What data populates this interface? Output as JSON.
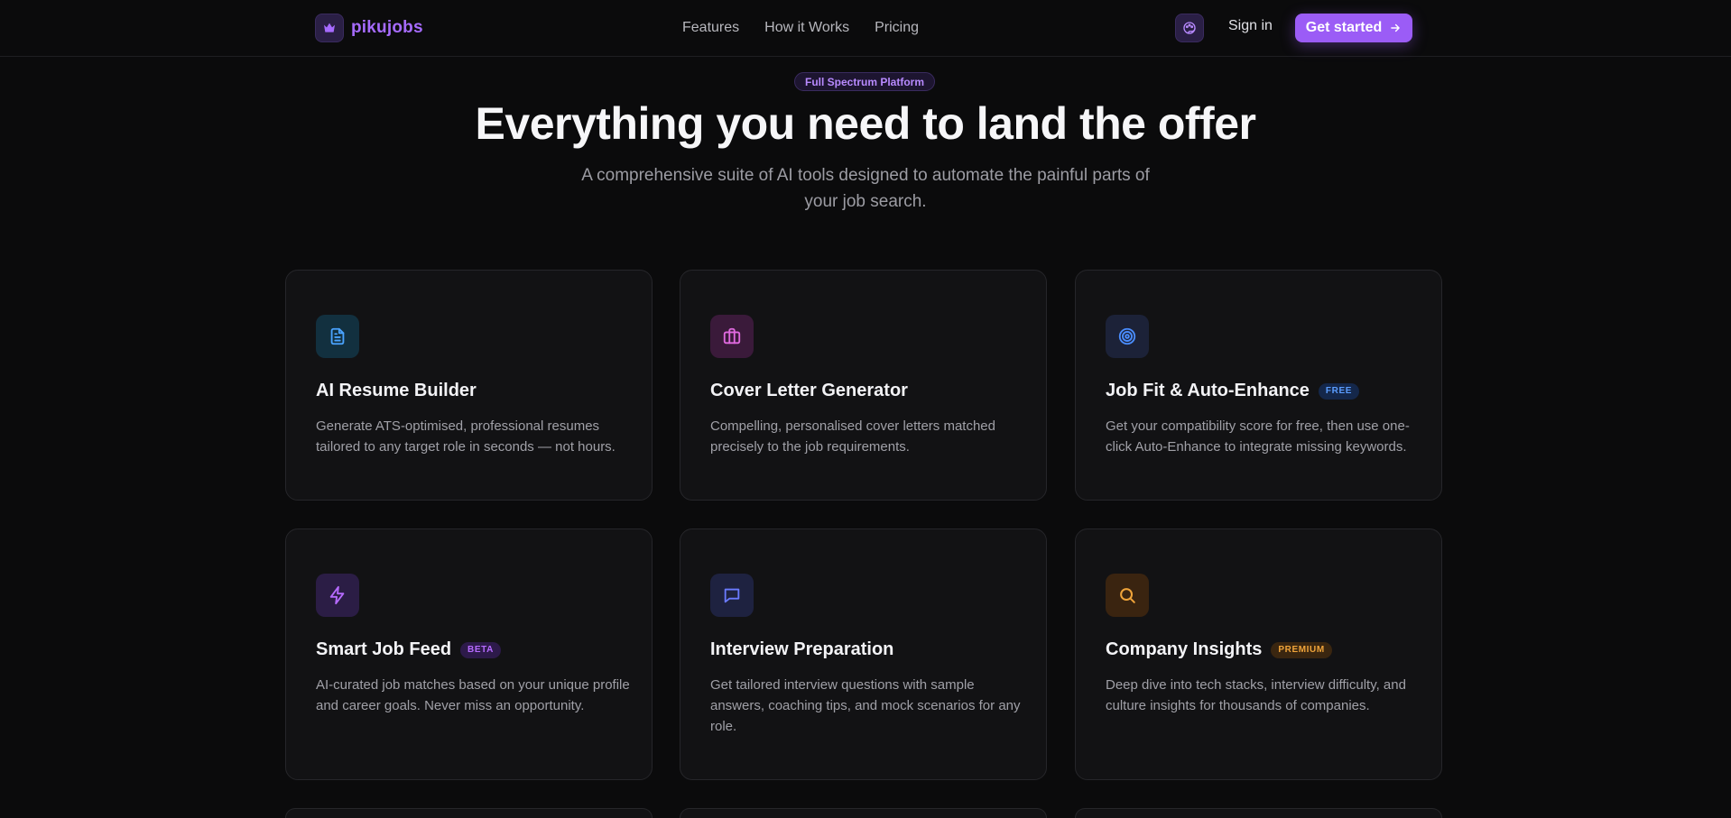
{
  "nav": {
    "brand": "pikujobs",
    "links": [
      "Features",
      "How it Works",
      "Pricing"
    ],
    "sign_in": "Sign in",
    "cta": "Get started"
  },
  "hero": {
    "pill": "Full Spectrum Platform",
    "title": "Everything you need to land the offer",
    "subtitle": "A comprehensive suite of AI tools designed to automate the painful parts of your job search."
  },
  "features": [
    {
      "title": "AI Resume Builder",
      "badge": "",
      "description": "Generate ATS-optimised, professional resumes tailored to any target role in seconds — not hours.",
      "icon": "document-icon"
    },
    {
      "title": "Cover Letter Generator",
      "badge": "",
      "description": "Compelling, personalised cover letters matched precisely to the job requirements.",
      "icon": "briefcase-icon"
    },
    {
      "title": "Job Fit & Auto-Enhance",
      "badge": "FREE",
      "description": "Get your compatibility score for free, then use one-click Auto-Enhance to integrate missing keywords.",
      "icon": "target-icon"
    },
    {
      "title": "Smart Job Feed",
      "badge": "BETA",
      "description": "AI-curated job matches based on your unique profile and career goals. Never miss an opportunity.",
      "icon": "lightning-icon"
    },
    {
      "title": "Interview Preparation",
      "badge": "",
      "description": "Get tailored interview questions with sample answers, coaching tips, and mock scenarios for any role.",
      "icon": "chat-icon"
    },
    {
      "title": "Company Insights",
      "badge": "PREMIUM",
      "description": "Deep dive into tech stacks, interview difficulty, and culture insights for thousands of companies.",
      "icon": "search-icon"
    }
  ],
  "colors": {
    "accent": "#9b5cf6",
    "background": "#0b0b0c",
    "card": "#121214"
  }
}
